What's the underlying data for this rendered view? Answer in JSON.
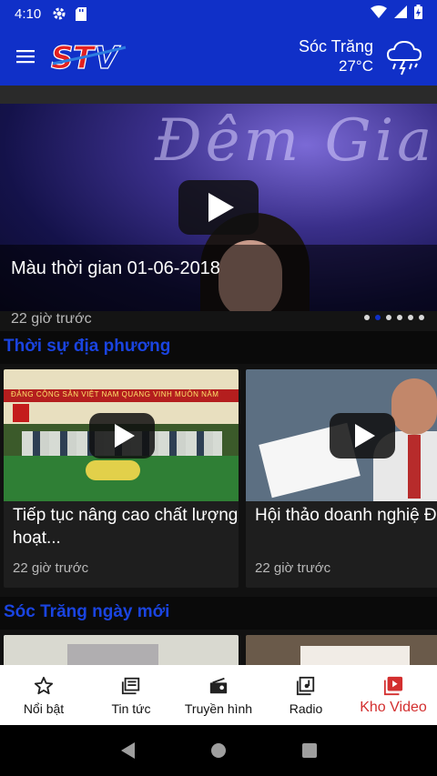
{
  "status_bar": {
    "time": "4:10",
    "icons": [
      "gear-icon",
      "sdcard-icon",
      "wifi-icon",
      "signal-icon",
      "battery-charging-icon"
    ]
  },
  "app_bar": {
    "menu_icon": "menu-icon",
    "logo_text": "STV",
    "weather": {
      "city": "Sóc Trăng",
      "temperature": "27°C",
      "icon": "rain-thunder-cloud-icon"
    }
  },
  "hero": {
    "title": "Màu thời gian 01-06-2018",
    "time": "22 giờ trước",
    "stage_text": "Đêm Gia",
    "dots_total": 6,
    "dots_active_index": 1
  },
  "sections": [
    {
      "title": "Thời sự địa phương",
      "cards": [
        {
          "title": "Tiếp tục nâng cao chất lượng hoạt...",
          "time": "22 giờ trước",
          "banner": "ĐẢNG CỘNG SẢN VIỆT NAM QUANG VINH MUÔN NĂM"
        },
        {
          "title": "Hội thảo doanh nghiệ ĐBSCL ứng phó...",
          "time": "22 giờ trước"
        }
      ]
    },
    {
      "title": "Sóc Trăng ngày mới"
    }
  ],
  "bottom_nav": [
    {
      "label": "Nổi bật",
      "icon": "star-icon"
    },
    {
      "label": "Tin tức",
      "icon": "news-icon"
    },
    {
      "label": "Truyền hình",
      "icon": "tv-icon"
    },
    {
      "label": "Radio",
      "icon": "radio-icon"
    },
    {
      "label": "Kho Video",
      "icon": "video-library-icon",
      "active": true
    }
  ],
  "colors": {
    "primary": "#1030c8",
    "section_title": "#1a44e0",
    "active_nav": "#d32f2f"
  }
}
